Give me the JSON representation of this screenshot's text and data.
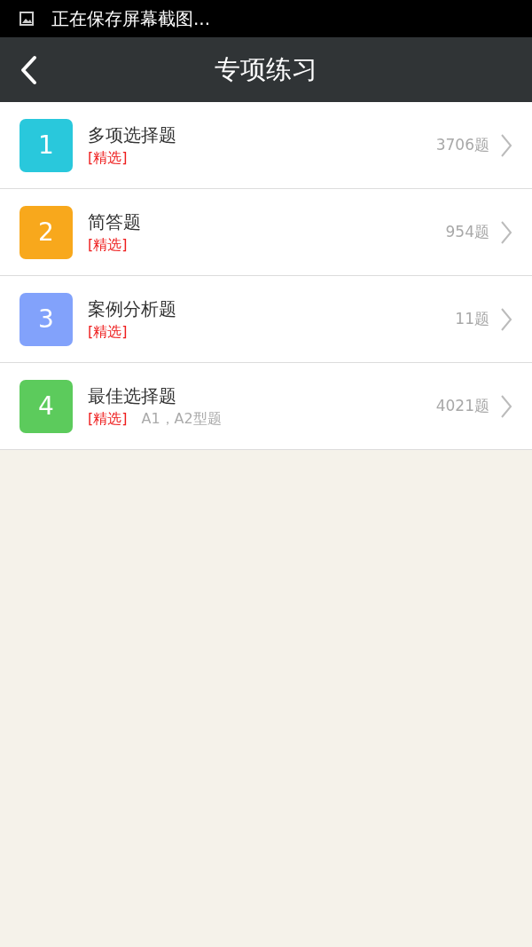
{
  "status_bar": {
    "text": "正在保存屏幕截图..."
  },
  "header": {
    "title": "专项练习"
  },
  "items": [
    {
      "number": "1",
      "color": "#29c8dc",
      "title": "多项选择题",
      "tag": "[精选]",
      "count": "3706题"
    },
    {
      "number": "2",
      "color": "#f8a81c",
      "title": "简答题",
      "tag": "[精选]",
      "count": "954题"
    },
    {
      "number": "3",
      "color": "#82a2fb",
      "title": "案例分析题",
      "tag": "[精选]",
      "count": "11题"
    },
    {
      "number": "4",
      "color": "#5ccb5c",
      "title": "最佳选择题",
      "tag": "[精选]",
      "note": "A1，A2型题",
      "count": "4021题"
    }
  ]
}
